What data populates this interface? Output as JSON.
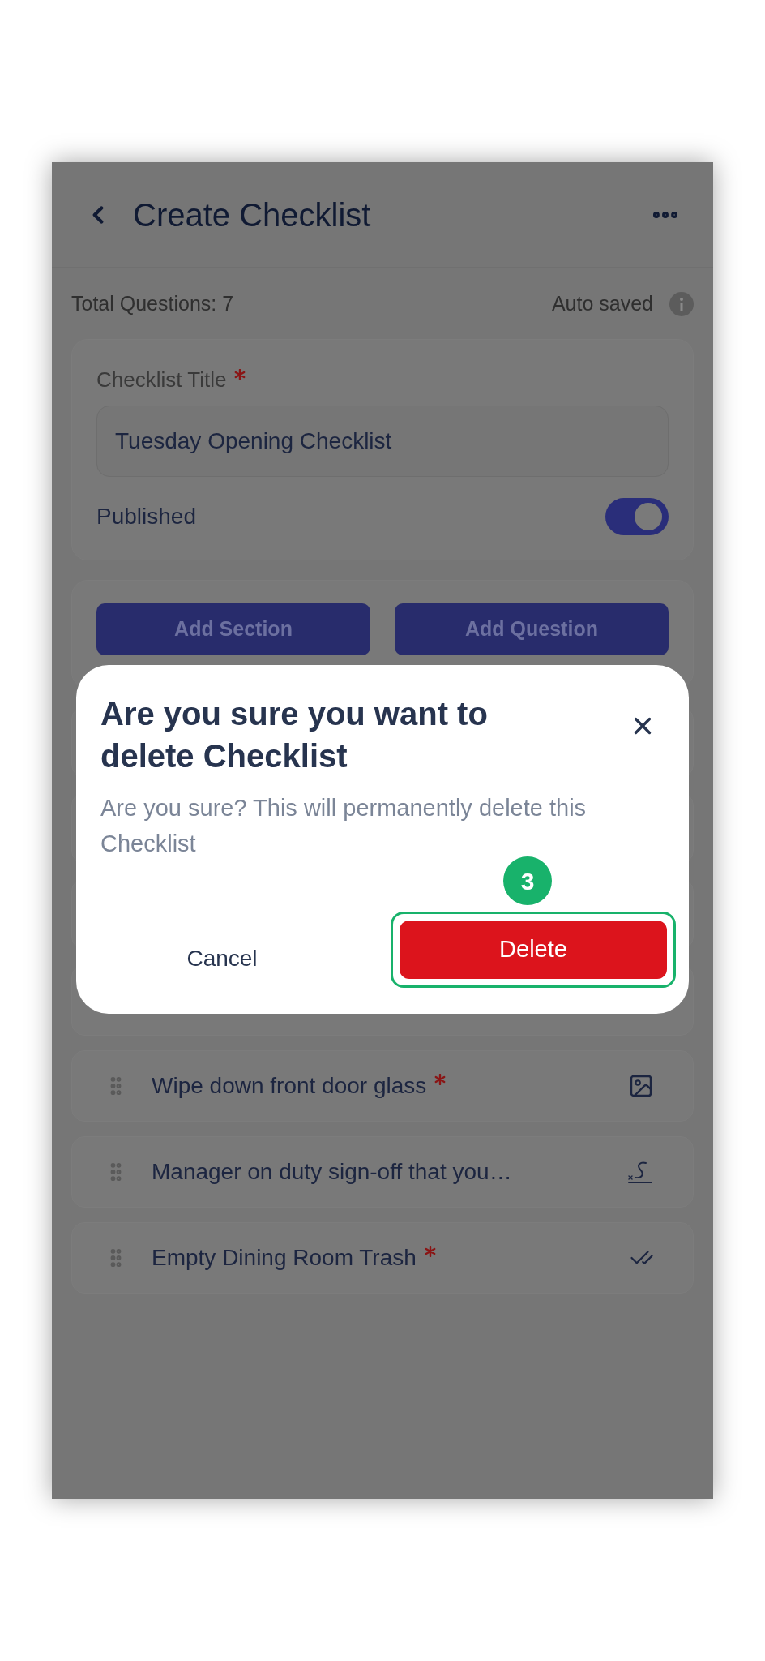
{
  "header": {
    "title": "Create Checklist"
  },
  "summary": {
    "total": "Total Questions: 7",
    "status": "Auto saved"
  },
  "title_field": {
    "label": "Checklist Title",
    "required": true,
    "value": "Tuesday Opening Checklist"
  },
  "published": {
    "label": "Published",
    "on": true
  },
  "actions": [
    "Add Section",
    "Add Question"
  ],
  "questions": [
    {
      "text": "Wipe down front door glass",
      "required": true,
      "kind": "photo"
    },
    {
      "text": "Manager on duty sign-off that you…",
      "required": false,
      "kind": "signature"
    },
    {
      "text": "Empty Dining Room Trash",
      "required": true,
      "kind": "check"
    }
  ],
  "dialog": {
    "title": "Are you sure you want to delete Checklist",
    "message": "Are you sure? This will permanently delete this Checklist",
    "cancel": "Cancel",
    "confirm": "Delete",
    "step": "3"
  }
}
